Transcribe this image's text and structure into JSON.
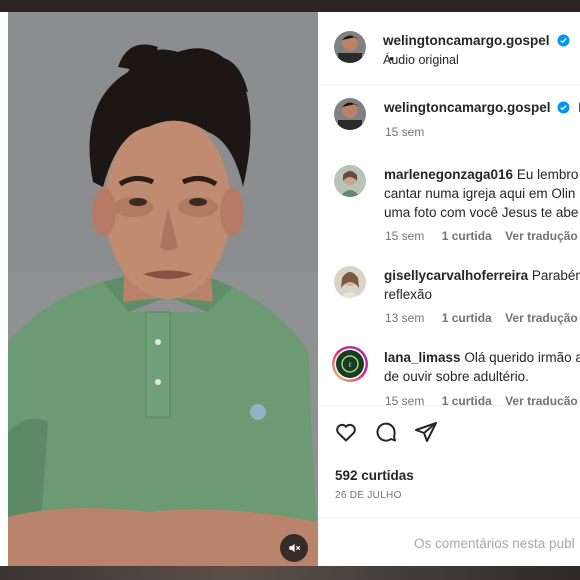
{
  "header": {
    "username": "welingtoncamargo.gospel",
    "separator": "•",
    "audio_label": "Áudio original"
  },
  "comments": [
    {
      "username": "welingtoncamargo.gospel",
      "verified": true,
      "text": "H",
      "time": "15 sem",
      "likes": "",
      "translate": ""
    },
    {
      "username": "marlenegonzaga016",
      "verified": false,
      "lines": [
        "Eu lembro",
        "cantar numa igreja aqui em Olin",
        "uma foto com você Jesus te abe"
      ],
      "time": "15 sem",
      "likes": "1 curtida",
      "translate": "Ver tradução"
    },
    {
      "username": "gisellycarvalhoferreira",
      "verified": false,
      "lines": [
        "Parabéns",
        "reflexão"
      ],
      "time": "13 sem",
      "likes": "1 curtida",
      "translate": "Ver tradução",
      "more": "••"
    },
    {
      "username": "lana_limass",
      "verified": false,
      "lines": [
        "Olá querido irmão a",
        "de ouvir sobre adultério."
      ],
      "time": "15 sem",
      "likes": "1 curtida",
      "translate": "Ver tradução"
    }
  ],
  "post": {
    "likes_label": "592 curtidas",
    "date_label": "26 DE JULHO"
  },
  "comment_box": {
    "disabled_text": "Os comentários nesta publ"
  },
  "icons": {
    "like": "heart-icon",
    "comment": "comment-icon",
    "share": "send-icon",
    "mute": "muted-speaker-icon",
    "verified": "verified-badge-icon"
  },
  "colors": {
    "verified_blue": "#0095f6",
    "shirt_green": "#6a9a72",
    "muted_text": "#737373"
  }
}
